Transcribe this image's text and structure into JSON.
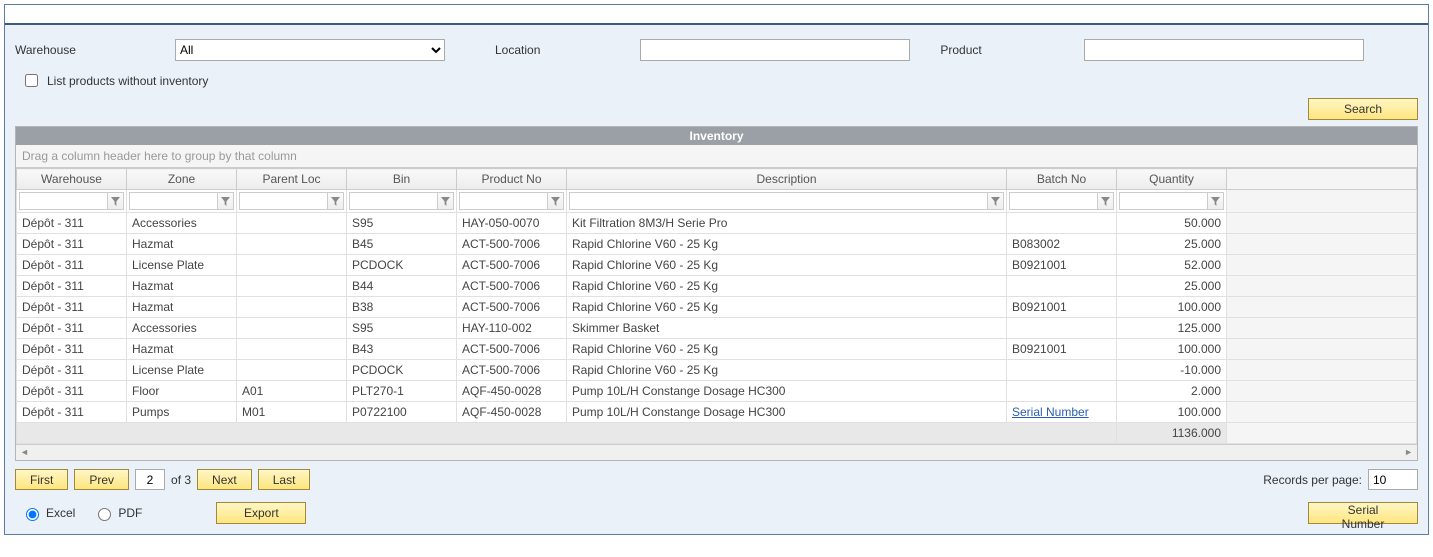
{
  "filters": {
    "warehouse_label": "Warehouse",
    "warehouse_value": "All",
    "location_label": "Location",
    "location_value": "",
    "product_label": "Product",
    "product_value": "",
    "no_inventory_label": "List products without inventory",
    "search_button": "Search"
  },
  "grid": {
    "title": "Inventory",
    "group_hint": "Drag a column header here to group by that column",
    "columns": {
      "warehouse": "Warehouse",
      "zone": "Zone",
      "parent_loc": "Parent Loc",
      "bin": "Bin",
      "product_no": "Product No",
      "description": "Description",
      "batch_no": "Batch No",
      "quantity": "Quantity"
    },
    "rows": [
      {
        "warehouse": "Dépôt - 311",
        "zone": "Accessories",
        "parent_loc": "",
        "bin": "S95",
        "product_no": "HAY-050-0070",
        "description": "Kit Filtration 8M3/H Serie Pro",
        "batch_no": "",
        "quantity": "50.000"
      },
      {
        "warehouse": "Dépôt - 311",
        "zone": "Hazmat",
        "parent_loc": "",
        "bin": "B45",
        "product_no": "ACT-500-7006",
        "description": "Rapid Chlorine V60 - 25 Kg",
        "batch_no": "B083002",
        "quantity": "25.000"
      },
      {
        "warehouse": "Dépôt - 311",
        "zone": "License Plate",
        "parent_loc": "",
        "bin": "PCDOCK",
        "product_no": "ACT-500-7006",
        "description": "Rapid Chlorine V60 - 25 Kg",
        "batch_no": "B0921001",
        "quantity": "52.000"
      },
      {
        "warehouse": "Dépôt - 311",
        "zone": "Hazmat",
        "parent_loc": "",
        "bin": "B44",
        "product_no": "ACT-500-7006",
        "description": "Rapid Chlorine V60 - 25 Kg",
        "batch_no": "",
        "quantity": "25.000"
      },
      {
        "warehouse": "Dépôt - 311",
        "zone": "Hazmat",
        "parent_loc": "",
        "bin": "B38",
        "product_no": "ACT-500-7006",
        "description": "Rapid Chlorine V60 - 25 Kg",
        "batch_no": "B0921001",
        "quantity": "100.000"
      },
      {
        "warehouse": "Dépôt - 311",
        "zone": "Accessories",
        "parent_loc": "",
        "bin": "S95",
        "product_no": "HAY-110-002",
        "description": "Skimmer Basket",
        "batch_no": "",
        "quantity": "125.000"
      },
      {
        "warehouse": "Dépôt - 311",
        "zone": "Hazmat",
        "parent_loc": "",
        "bin": "B43",
        "product_no": "ACT-500-7006",
        "description": "Rapid Chlorine V60 - 25 Kg",
        "batch_no": "B0921001",
        "quantity": "100.000"
      },
      {
        "warehouse": "Dépôt - 311",
        "zone": "License Plate",
        "parent_loc": "",
        "bin": "PCDOCK",
        "product_no": "ACT-500-7006",
        "description": "Rapid Chlorine V60 - 25 Kg",
        "batch_no": "",
        "quantity": "-10.000"
      },
      {
        "warehouse": "Dépôt - 311",
        "zone": "Floor",
        "parent_loc": "A01",
        "bin": "PLT270-1",
        "product_no": "AQF-450-0028",
        "description": "Pump 10L/H Constange Dosage HC300",
        "batch_no": "",
        "quantity": "2.000"
      },
      {
        "warehouse": "Dépôt - 311",
        "zone": "Pumps",
        "parent_loc": "M01",
        "bin": "P0722100",
        "product_no": "AQF-450-0028",
        "description": "Pump 10L/H Constange Dosage HC300",
        "batch_no": "__serial__",
        "quantity": "100.000"
      }
    ],
    "serial_link": "Serial Number",
    "total_quantity": "1136.000"
  },
  "pager": {
    "first": "First",
    "prev": "Prev",
    "page": "2",
    "of_label": "of 3",
    "next": "Next",
    "last": "Last",
    "rpp_label": "Records per page:",
    "rpp_value": "10"
  },
  "export": {
    "excel_label": "Excel",
    "pdf_label": "PDF",
    "export_button": "Export",
    "serial_button": "Serial Number"
  }
}
